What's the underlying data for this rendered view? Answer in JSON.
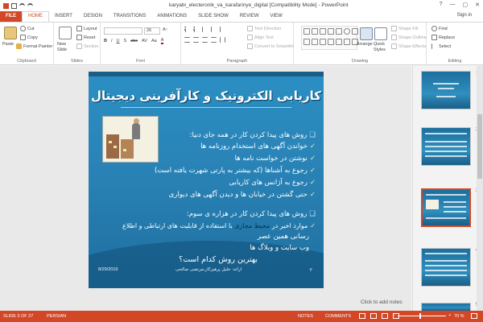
{
  "app": {
    "title": "karyabi_electeronik_va_karafarinye_digital [Compatibility Mode] - PowerPoint",
    "sign_in": "Sign in",
    "window_buttons": [
      "?",
      "—",
      "▢",
      "✕"
    ]
  },
  "tabs": [
    {
      "label": "FILE"
    },
    {
      "label": "HOME"
    },
    {
      "label": "INSERT"
    },
    {
      "label": "DESIGN"
    },
    {
      "label": "TRANSITIONS"
    },
    {
      "label": "ANIMATIONS"
    },
    {
      "label": "SLIDE SHOW"
    },
    {
      "label": "REVIEW"
    },
    {
      "label": "VIEW"
    }
  ],
  "ribbon": {
    "clipboard": {
      "paste": "Paste",
      "cut": "Cut",
      "copy": "Copy",
      "format_painter": "Format Painter",
      "label": "Clipboard"
    },
    "slides": {
      "new_slide": "New Slide",
      "layout": "Layout",
      "reset": "Reset",
      "section": "Section",
      "label": "Slides"
    },
    "font": {
      "font_size": "26",
      "buttons": [
        "B",
        "I",
        "U",
        "S",
        "abc",
        "AV",
        "Aa",
        "A"
      ],
      "label": "Font"
    },
    "paragraph": {
      "text_direction": "Text Direction",
      "align_text": "Align Text",
      "convert_smartart": "Convert to SmartArt",
      "label": "Paragraph"
    },
    "drawing": {
      "arrange": "Arrange",
      "quick_styles": "Quick Styles",
      "shape_fill": "Shape Fill",
      "shape_outline": "Shape Outline",
      "shape_effects": "Shape Effects",
      "label": "Drawing"
    },
    "editing": {
      "find": "Find",
      "replace": "Replace",
      "select": "Select",
      "label": "Editing"
    }
  },
  "slide": {
    "title": "کاریابی الکترونیک و کارآفرینی دیجیتال",
    "paragraphs": [
      {
        "marker": "❑",
        "text": "روش های پیدا کردن کار در همه جای دنیا:",
        "head": true
      },
      {
        "marker": "✓",
        "text": "خواندن آگهی های استخدام روزنامه ها"
      },
      {
        "marker": "✓",
        "text": "نوشتن در خواست نامه ها"
      },
      {
        "marker": "✓",
        "text": "رجوع به آشناها (که بیشتر به پارتی شهرت یافته است)"
      },
      {
        "marker": "✓",
        "text": "رجوع به آژانس های کاریابی"
      },
      {
        "marker": "✓",
        "text": "حتی گشتن در خیابان ها و دیدن آگهی های دیواری"
      },
      {
        "marker": "❑",
        "text": "روش های پیدا کردن کار در هزاره ی سوم:",
        "head": true
      },
      {
        "marker": "✓",
        "text_a": "موارد اخیر در",
        "text_dark": "محیط مجازی",
        "text_b": "با استفاده از قابلیت های ارتباطی و اطلاع"
      },
      {
        "marker": "",
        "text": "رسانی همین عصر"
      },
      {
        "marker": "",
        "text": "وب سایت و وبلاگ ها"
      },
      {
        "marker": "",
        "text": "بهترین روش کدام است؟",
        "center": true
      }
    ],
    "date": "8/29/2019",
    "footer": "ارائه: خلیل پرهیزکار،مرتضی صالحی",
    "number": "۲"
  },
  "notes_placeholder": "Click to add notes",
  "thumbnails": [
    {
      "number": "1"
    },
    {
      "number": "2"
    },
    {
      "number": "3",
      "selected": true
    },
    {
      "number": "4"
    },
    {
      "number": "5"
    }
  ],
  "status": {
    "slide_indicator": "SLIDE 3 OF 27",
    "language": "PERSIAN",
    "notes": "NOTES",
    "comments": "COMMENTS",
    "zoom": "70 %"
  },
  "colors": {
    "accent": "#d24726",
    "slide_blue": "#2a84b8"
  }
}
